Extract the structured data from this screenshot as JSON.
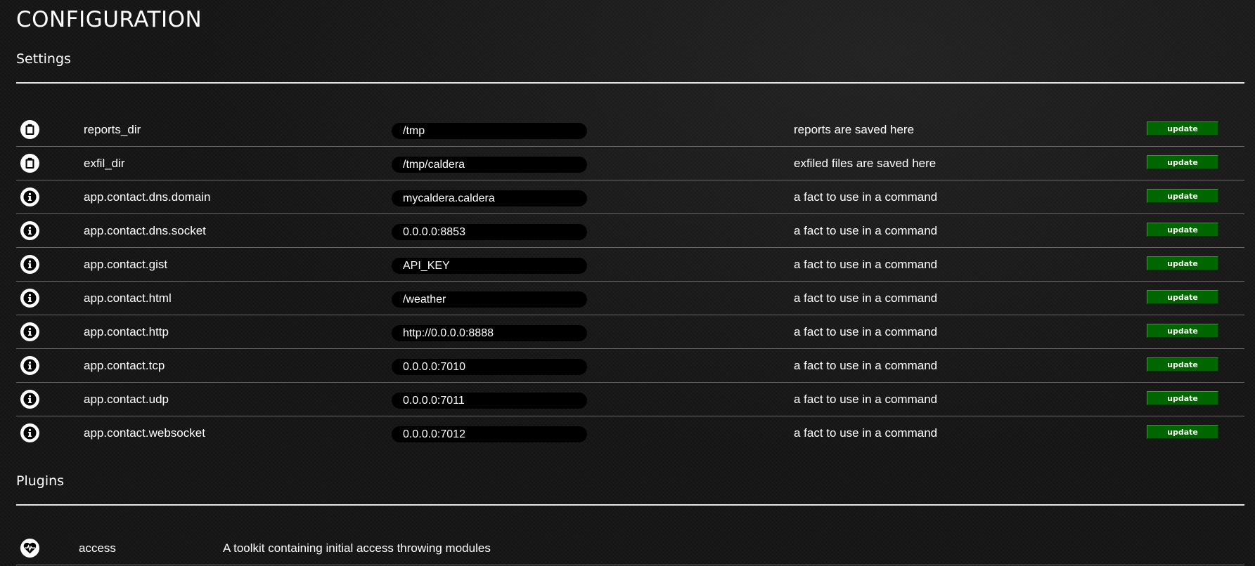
{
  "page": {
    "title": "CONFIGURATION"
  },
  "settings": {
    "title": "Settings",
    "update_label": "update",
    "rows": [
      {
        "icon": "clipboard-icon",
        "name": "reports_dir",
        "value": "/tmp",
        "description": "reports are saved here"
      },
      {
        "icon": "clipboard-icon",
        "name": "exfil_dir",
        "value": "/tmp/caldera",
        "description": "exfiled files are saved here"
      },
      {
        "icon": "info-icon",
        "name": "app.contact.dns.domain",
        "value": "mycaldera.caldera",
        "description": "a fact to use in a command"
      },
      {
        "icon": "info-icon",
        "name": "app.contact.dns.socket",
        "value": "0.0.0.0:8853",
        "description": "a fact to use in a command"
      },
      {
        "icon": "info-icon",
        "name": "app.contact.gist",
        "value": "API_KEY",
        "description": "a fact to use in a command"
      },
      {
        "icon": "info-icon",
        "name": "app.contact.html",
        "value": "/weather",
        "description": "a fact to use in a command"
      },
      {
        "icon": "info-icon",
        "name": "app.contact.http",
        "value": "http://0.0.0.0:8888",
        "description": "a fact to use in a command"
      },
      {
        "icon": "info-icon",
        "name": "app.contact.tcp",
        "value": "0.0.0.0:7010",
        "description": "a fact to use in a command"
      },
      {
        "icon": "info-icon",
        "name": "app.contact.udp",
        "value": "0.0.0.0:7011",
        "description": "a fact to use in a command"
      },
      {
        "icon": "info-icon",
        "name": "app.contact.websocket",
        "value": "0.0.0.0:7012",
        "description": "a fact to use in a command"
      }
    ]
  },
  "plugins": {
    "title": "Plugins",
    "rows": [
      {
        "icon": "heartbeat-icon",
        "name": "access",
        "description": "A toolkit containing initial access throwing modules"
      }
    ]
  },
  "colors": {
    "background": "#131313",
    "button_green": "#006600",
    "input_background": "#000000",
    "text": "#ffffff"
  }
}
